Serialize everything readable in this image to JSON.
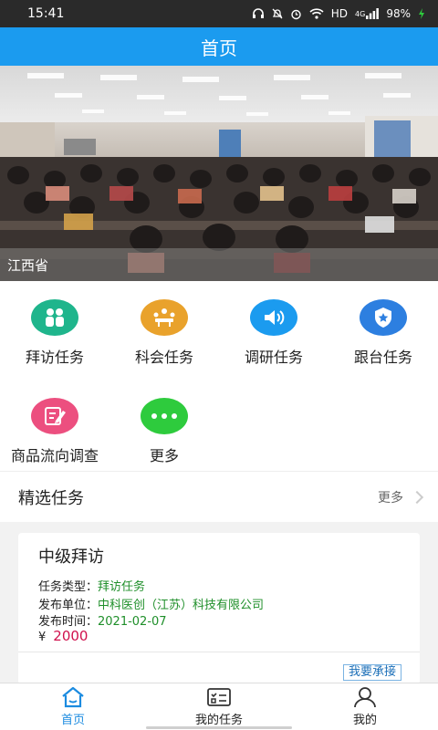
{
  "status": {
    "time": "15:41",
    "network": "HD",
    "signal": "4G",
    "battery": "98%"
  },
  "header": {
    "title": "首页"
  },
  "banner": {
    "caption": "江西省",
    "dots": 4,
    "active_dot": 2
  },
  "features": [
    {
      "label": "拜访任务",
      "color": "#1fb58c",
      "icon": "people-icon"
    },
    {
      "label": "科会任务",
      "color": "#e9a22c",
      "icon": "meeting-icon"
    },
    {
      "label": "调研任务",
      "color": "#1b9bef",
      "icon": "speaker-icon"
    },
    {
      "label": "跟台任务",
      "color": "#2d7fe0",
      "icon": "shield-star-icon"
    },
    {
      "label": "商品流向调查",
      "color": "#ec4f7f",
      "icon": "edit-icon"
    },
    {
      "label": "更多",
      "color": "#2ecb3d",
      "icon": "more-dots-icon"
    }
  ],
  "featured": {
    "title": "精选任务",
    "more": "更多"
  },
  "task": {
    "title": "中级拜访",
    "type_label": "任务类型：",
    "type_value": "拜访任务",
    "org_label": "发布单位：",
    "org_value": "中科医创（江苏）科技有限公司",
    "time_label": "发布时间：",
    "time_value": "2021-02-07",
    "currency": "¥",
    "price": "2000",
    "accept": "我要承接"
  },
  "tabs": [
    {
      "label": "首页",
      "icon": "home-icon",
      "active": true
    },
    {
      "label": "我的任务",
      "icon": "task-list-icon",
      "active": false
    },
    {
      "label": "我的",
      "icon": "user-icon",
      "active": false
    }
  ]
}
